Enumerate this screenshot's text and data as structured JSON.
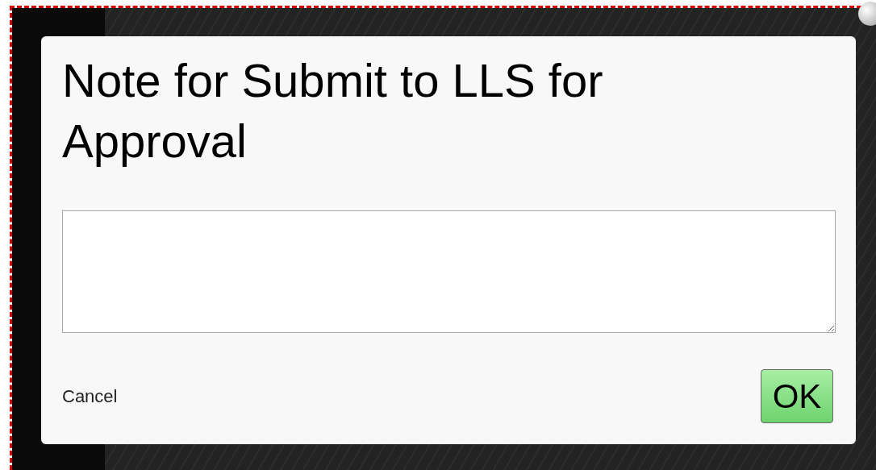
{
  "dialog": {
    "title": "Note for Submit to LLS for Approval",
    "cancel": "Cancel",
    "ok": "OK"
  }
}
